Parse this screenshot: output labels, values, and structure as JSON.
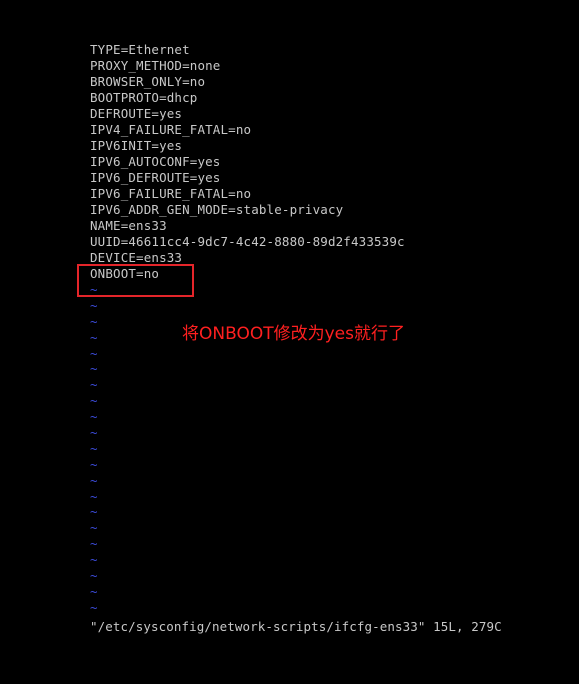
{
  "editor": {
    "lines": [
      "TYPE=Ethernet",
      "PROXY_METHOD=none",
      "BROWSER_ONLY=no",
      "BOOTPROTO=dhcp",
      "DEFROUTE=yes",
      "IPV4_FAILURE_FATAL=no",
      "IPV6INIT=yes",
      "IPV6_AUTOCONF=yes",
      "IPV6_DEFROUTE=yes",
      "IPV6_FAILURE_FATAL=no",
      "IPV6_ADDR_GEN_MODE=stable-privacy",
      "NAME=ens33",
      "UUID=46611cc4-9dc7-4c42-8880-89d2f433539c",
      "DEVICE=ens33",
      "ONBOOT=no"
    ],
    "empty_line_marker": "~",
    "empty_line_count": 21,
    "status_line": "\"/etc/sysconfig/network-scripts/ifcfg-ens33\" 15L, 279C"
  },
  "annotation": {
    "text": "将ONBOOT修改为yes就行了",
    "color": "#ff2020",
    "box_color": "#e5252a"
  },
  "colors": {
    "background": "#000000",
    "text": "#c8c8c8",
    "tilde": "#3b4bd8"
  }
}
